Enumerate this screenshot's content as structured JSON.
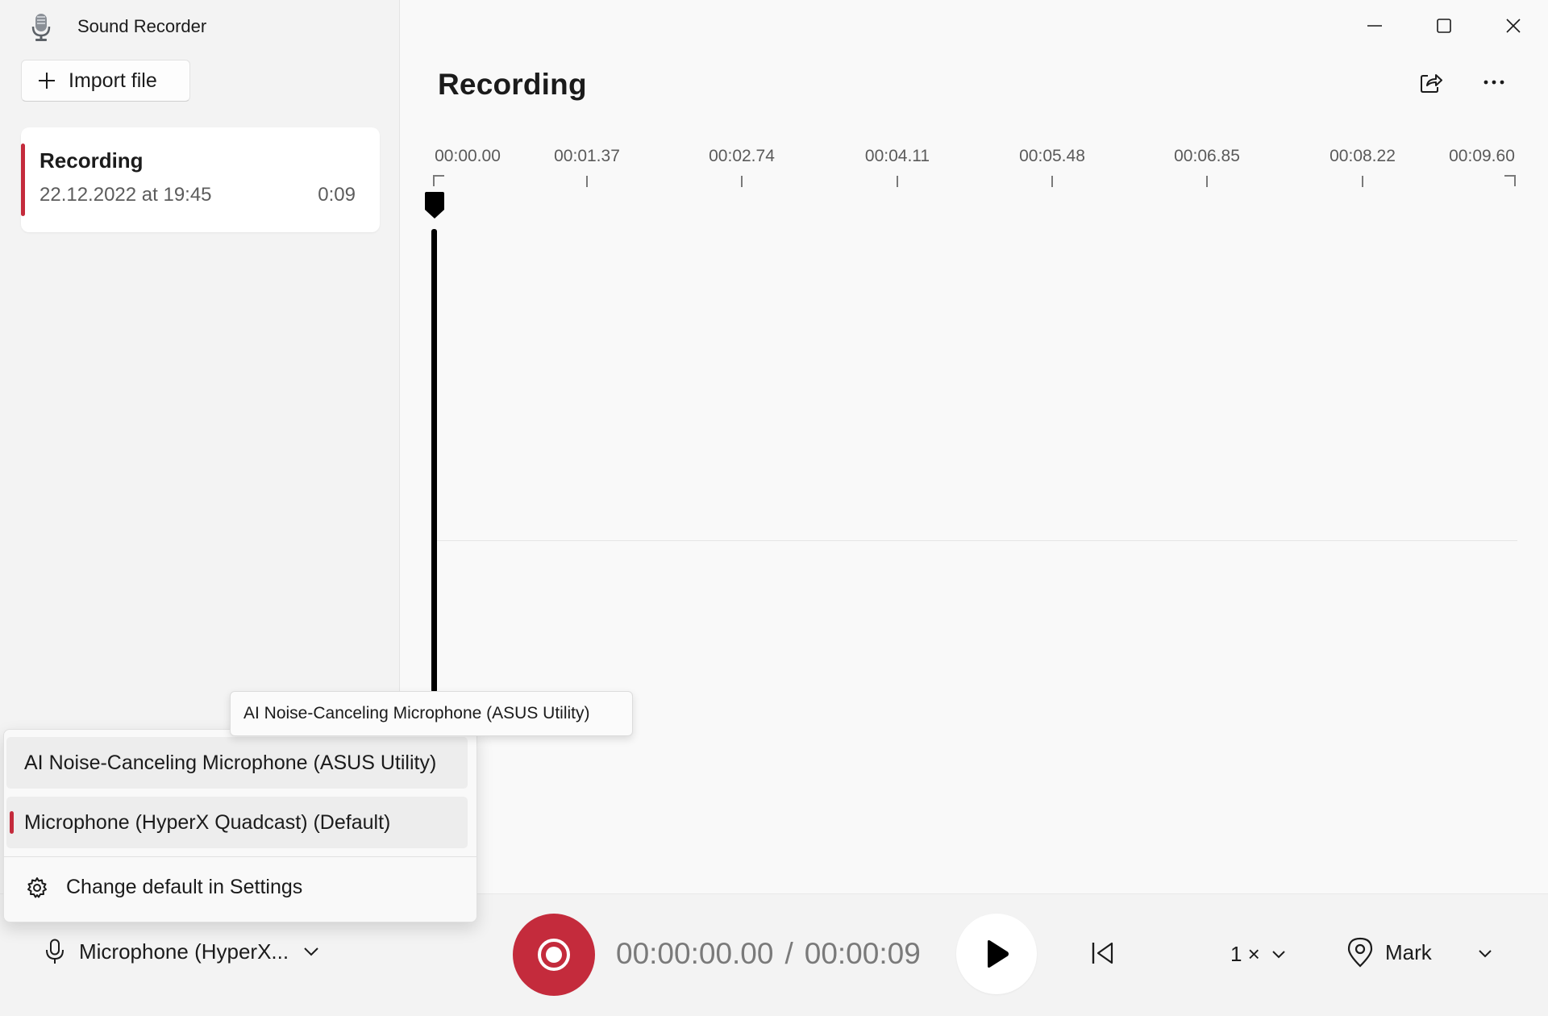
{
  "app": {
    "title": "Sound Recorder",
    "icon": "microphone-app-icon"
  },
  "sidebar": {
    "import_label": "Import file",
    "recordings": [
      {
        "name": "Recording",
        "date": "22.12.2022 at 19:45",
        "duration": "0:09"
      }
    ]
  },
  "window_controls": [
    "minimize-icon",
    "maximize-icon",
    "close-icon"
  ],
  "main": {
    "title": "Recording",
    "share_icon": "share-icon",
    "more_icon": "more-icon"
  },
  "timeline": {
    "ticks": [
      "00:00.00",
      "00:01.37",
      "00:02.74",
      "00:04.11",
      "00:05.48",
      "00:06.85",
      "00:08.22",
      "00:09.60"
    ]
  },
  "mic_dropdown": {
    "items": [
      {
        "label": "AI Noise-Canceling Microphone (ASUS Utility)",
        "state": "hover"
      },
      {
        "label": "Microphone (HyperX Quadcast) (Default)",
        "state": "selected"
      }
    ],
    "settings_label": "Change default in Settings",
    "tooltip": "AI Noise-Canceling Microphone (ASUS Utility)"
  },
  "bottom": {
    "mic_label": "Microphone (HyperX...",
    "current_time": "00:00:00.00",
    "separator": "/",
    "total_time": "00:00:09",
    "speed": "1 ×",
    "mark_label": "Mark"
  },
  "colors": {
    "accent": "#c42b3c",
    "background": "#f9f9f9",
    "sidebar": "#f3f3f3"
  }
}
